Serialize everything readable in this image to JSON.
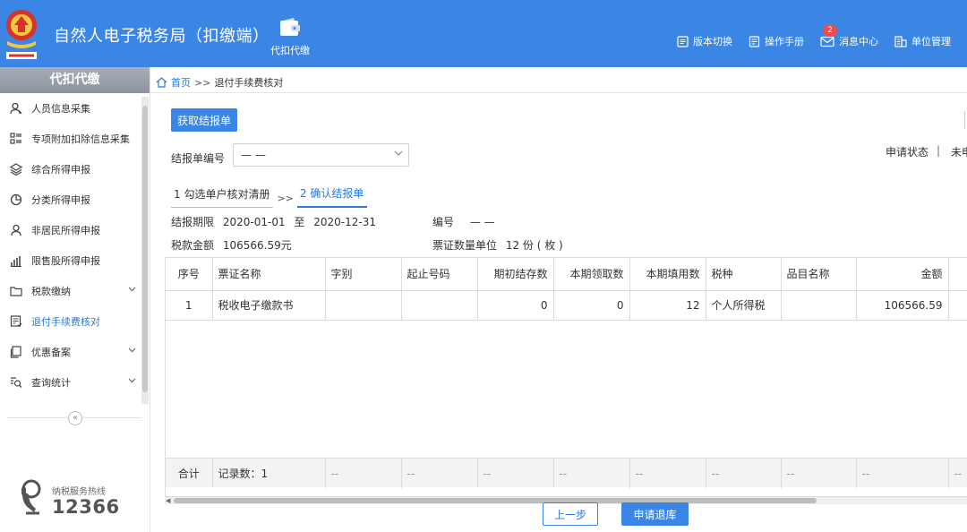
{
  "header": {
    "app_title": "自然人电子税务局（扣缴端）",
    "module_label": "代扣代缴",
    "links": [
      {
        "label": "版本切换",
        "icon": "version-switch-icon"
      },
      {
        "label": "操作手册",
        "icon": "manual-icon"
      },
      {
        "label": "消息中心",
        "icon": "mail-icon",
        "badge": "2"
      },
      {
        "label": "单位管理",
        "icon": "building-icon"
      }
    ]
  },
  "sidebar": {
    "title": "代扣代缴",
    "items": [
      {
        "label": "人员信息采集",
        "icon": "person-icon"
      },
      {
        "label": "专项附加扣除信息采集",
        "icon": "list-grid-icon"
      },
      {
        "label": "综合所得申报",
        "icon": "layers-icon"
      },
      {
        "label": "分类所得申报",
        "icon": "pie-icon"
      },
      {
        "label": "非居民所得申报",
        "icon": "user-outline-icon"
      },
      {
        "label": "限售股所得申报",
        "icon": "bar-chart-icon"
      },
      {
        "label": "税款缴纳",
        "icon": "folder-icon",
        "expandable": true
      },
      {
        "label": "退付手续费核对",
        "icon": "document-check-icon",
        "active": true
      },
      {
        "label": "优惠备案",
        "icon": "copy-icon",
        "expandable": true
      },
      {
        "label": "查询统计",
        "icon": "search-list-icon",
        "expandable": true
      }
    ],
    "collapse_symbol": "«",
    "hotline_label": "纳税服务热线",
    "hotline_number": "12366"
  },
  "breadcrumb": {
    "home": "首页",
    "sep": ">>",
    "current": "退付手续费核对"
  },
  "actions": {
    "fetch_label": "获取结报单",
    "prev_label": "上一步",
    "submit_label": "申请退库"
  },
  "filter": {
    "label": "结报单编号",
    "select_value": "— —",
    "status_label": "申请状态",
    "status_sep": "|",
    "status_value": "未申"
  },
  "steps": [
    {
      "label": "1 勾选单户核对清册",
      "active": false
    },
    {
      "label": "2 确认结报单",
      "active": true
    }
  ],
  "step_arrow": ">>",
  "info": {
    "period_label": "结报期限",
    "period_start": "2020-01-01",
    "period_to": "至",
    "period_end": "2020-12-31",
    "code_label": "编号",
    "code_value": "— —",
    "amount_label": "税款金额",
    "amount_value": "106566.59元",
    "count_label": "票证数量单位",
    "count_value": "12 份 ( 枚 )"
  },
  "table": {
    "headers": [
      "序号",
      "票证名称",
      "字别",
      "起止号码",
      "期初结存数",
      "本期领取数",
      "本期填用数",
      "税种",
      "品目名称",
      "金额"
    ],
    "rows": [
      [
        "1",
        "税收电子缴款书",
        "",
        "",
        "0",
        "0",
        "12",
        "个人所得税",
        "",
        "106566.59"
      ]
    ],
    "total": [
      "合计",
      "记录数：1",
      "--",
      "--",
      "--",
      "--",
      "--",
      "--",
      "--",
      "--",
      "--"
    ]
  }
}
